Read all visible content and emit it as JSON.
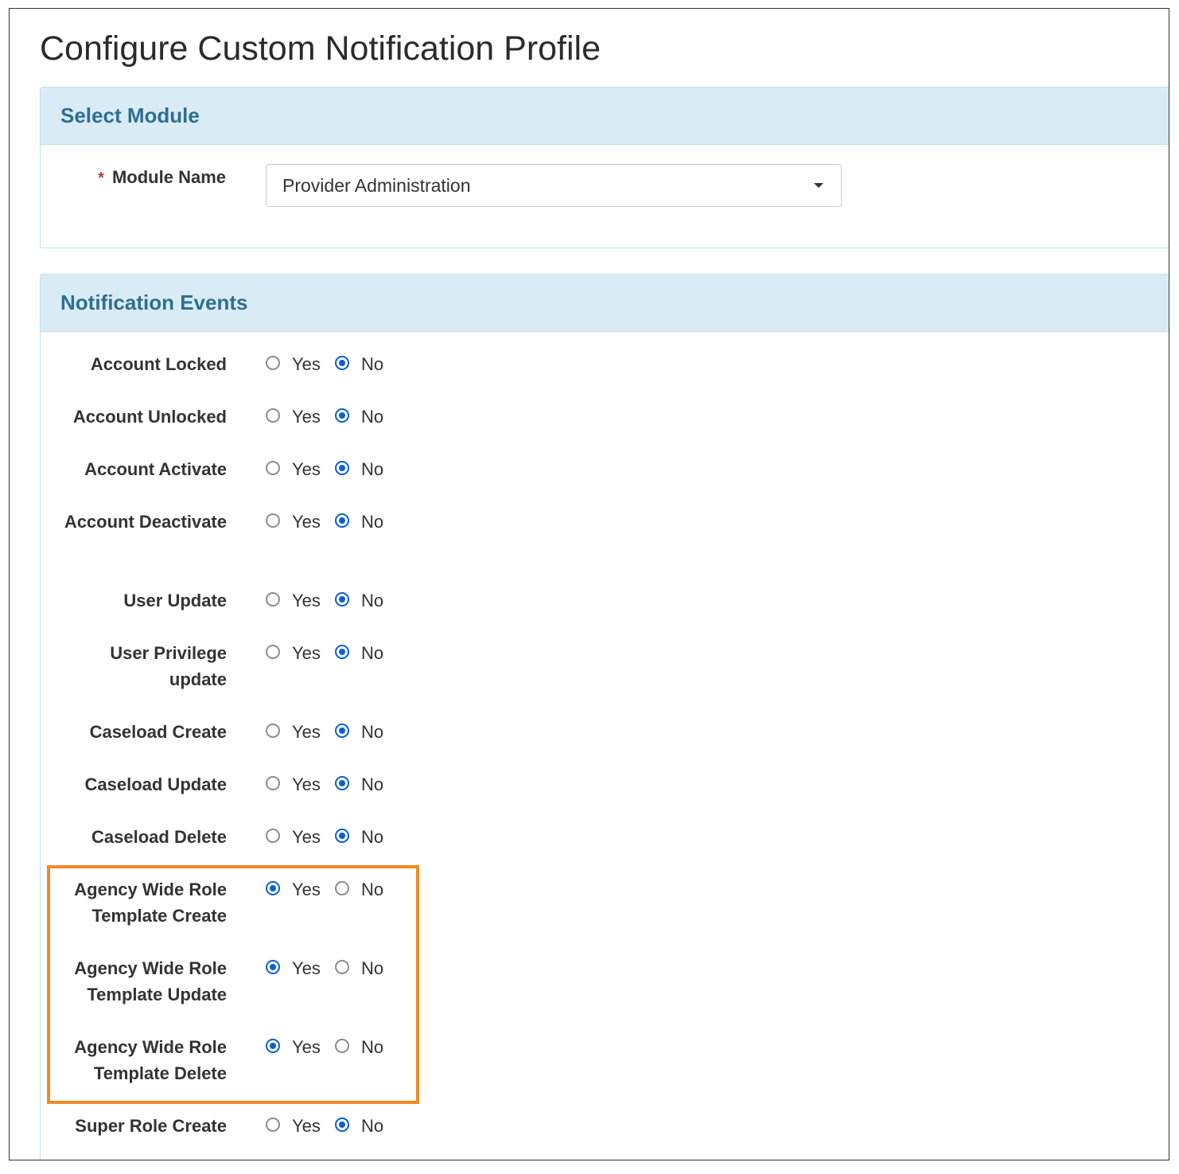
{
  "page_title": "Configure Custom Notification Profile",
  "module_panel": {
    "heading": "Select Module",
    "required_marker": "*",
    "field_label": "Module Name",
    "selected_value": "Provider Administration"
  },
  "events_panel": {
    "heading": "Notification Events",
    "option_yes": "Yes",
    "option_no": "No",
    "events": [
      {
        "label": "Account Locked",
        "value": "No"
      },
      {
        "label": "Account Unlocked",
        "value": "No"
      },
      {
        "label": "Account Activate",
        "value": "No"
      },
      {
        "label": "Account Deactivate",
        "value": "No"
      },
      {
        "label": "User Update",
        "value": "No"
      },
      {
        "label": "User Privilege update",
        "value": "No"
      },
      {
        "label": "Caseload Create",
        "value": "No"
      },
      {
        "label": "Caseload Update",
        "value": "No"
      },
      {
        "label": "Caseload Delete",
        "value": "No"
      },
      {
        "label": "Agency Wide Role Template Create",
        "value": "Yes"
      },
      {
        "label": "Agency Wide Role Template Update",
        "value": "Yes"
      },
      {
        "label": "Agency Wide Role Template Delete",
        "value": "Yes"
      },
      {
        "label": "Super Role Create",
        "value": "No"
      }
    ]
  },
  "colors": {
    "panel_heading_bg": "#d9ecf6",
    "panel_heading_text": "#2f6e92",
    "radio_checked": "#0a5fd8",
    "highlight_border": "#f08a24"
  }
}
